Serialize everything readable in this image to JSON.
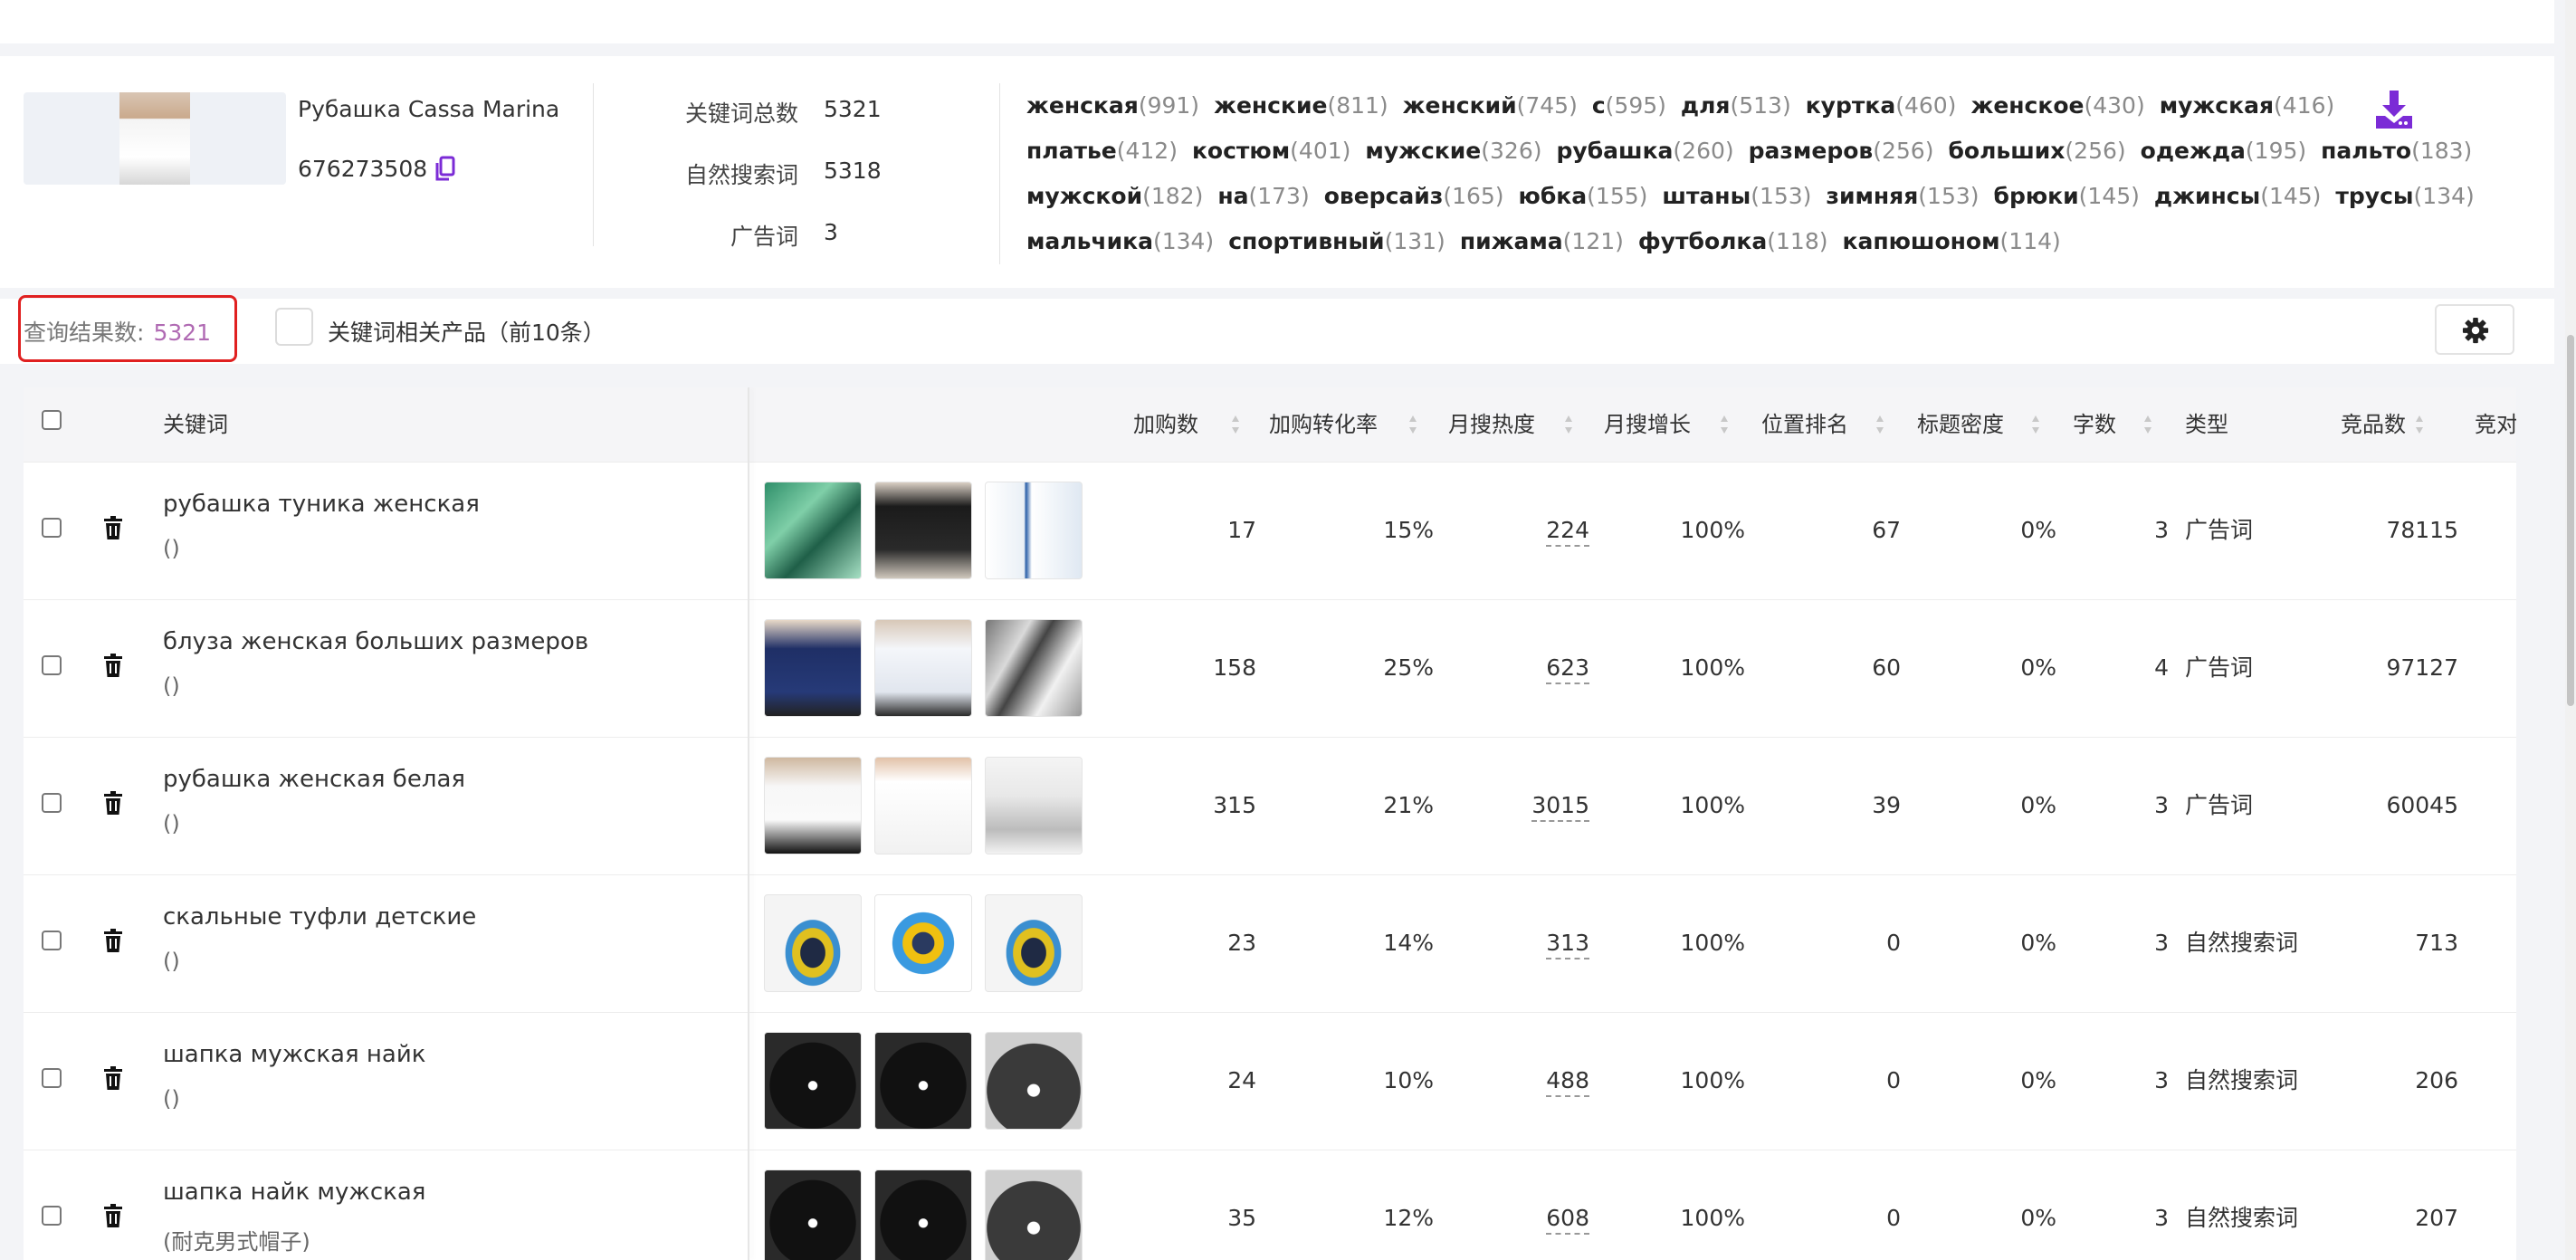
{
  "product": {
    "name": "Рубашка Cassa Marina",
    "id": "676273508"
  },
  "stats": {
    "total_label": "关键词总数",
    "total_value": "5321",
    "organic_label": "自然搜索词",
    "organic_value": "5318",
    "ad_label": "广告词",
    "ad_value": "3"
  },
  "keyword_cloud": [
    [
      [
        "женская",
        "(991)"
      ],
      [
        "женские",
        "(811)"
      ],
      [
        "женский",
        "(745)"
      ],
      [
        "с",
        "(595)"
      ],
      [
        "для",
        "(513)"
      ],
      [
        "куртка",
        "(460)"
      ],
      [
        "женское",
        "(430)"
      ],
      [
        "мужская",
        "(416)"
      ]
    ],
    [
      [
        "платье",
        "(412)"
      ],
      [
        "костюм",
        "(401)"
      ],
      [
        "мужские",
        "(326)"
      ],
      [
        "рубашка",
        "(260)"
      ],
      [
        "размеров",
        "(256)"
      ],
      [
        "больших",
        "(256)"
      ],
      [
        "одежда",
        "(195)"
      ],
      [
        "пальто",
        "(183)"
      ]
    ],
    [
      [
        "мужской",
        "(182)"
      ],
      [
        "на",
        "(173)"
      ],
      [
        "оверсайз",
        "(165)"
      ],
      [
        "юбка",
        "(155)"
      ],
      [
        "штаны",
        "(153)"
      ],
      [
        "зимняя",
        "(153)"
      ],
      [
        "брюки",
        "(145)"
      ],
      [
        "джинсы",
        "(145)"
      ],
      [
        "трусы",
        "(134)"
      ]
    ],
    [
      [
        "мальчика",
        "(134)"
      ],
      [
        "спортивный",
        "(131)"
      ],
      [
        "пижама",
        "(121)"
      ],
      [
        "футболка",
        "(118)"
      ],
      [
        "капюшоном",
        "(114)"
      ]
    ]
  ],
  "toolbar": {
    "result_label": "查询结果数:",
    "result_count": "5321",
    "related_label": "关键词相关产品（前10条）"
  },
  "columns": {
    "keyword": "关键词",
    "add_cart": "加购数",
    "add_cart_rate": "加购转化率",
    "monthly_heat": "月搜热度",
    "monthly_growth": "月搜增长",
    "position_rank": "位置排名",
    "title_density": "标题密度",
    "word_count": "字数",
    "type": "类型",
    "competitors": "竞品数",
    "competition": "竞对"
  },
  "rows": [
    {
      "keyword": "рубашка туника женская",
      "translation": "()",
      "add_cart": "17",
      "rate": "15%",
      "heat": "224",
      "growth": "100%",
      "rank": "67",
      "density": "0%",
      "words": "3",
      "type": "广告词",
      "competitors": "78115"
    },
    {
      "keyword": "блуза женская больших размеров",
      "translation": "()",
      "add_cart": "158",
      "rate": "25%",
      "heat": "623",
      "growth": "100%",
      "rank": "60",
      "density": "0%",
      "words": "4",
      "type": "广告词",
      "competitors": "97127"
    },
    {
      "keyword": "рубашка женская белая",
      "translation": "()",
      "add_cart": "315",
      "rate": "21%",
      "heat": "3015",
      "growth": "100%",
      "rank": "39",
      "density": "0%",
      "words": "3",
      "type": "广告词",
      "competitors": "60045"
    },
    {
      "keyword": "скальные туфли детские",
      "translation": "()",
      "add_cart": "23",
      "rate": "14%",
      "heat": "313",
      "growth": "100%",
      "rank": "0",
      "density": "0%",
      "words": "3",
      "type": "自然搜索词",
      "competitors": "713"
    },
    {
      "keyword": "шапка мужская найк",
      "translation": "()",
      "add_cart": "24",
      "rate": "10%",
      "heat": "488",
      "growth": "100%",
      "rank": "0",
      "density": "0%",
      "words": "3",
      "type": "自然搜索词",
      "competitors": "206"
    },
    {
      "keyword": "шапка найк мужская",
      "translation": "(耐克男式帽子)",
      "add_cart": "35",
      "rate": "12%",
      "heat": "608",
      "growth": "100%",
      "rank": "0",
      "density": "0%",
      "words": "3",
      "type": "自然搜索词",
      "competitors": "207"
    }
  ],
  "colors": {
    "accent_purple": "#7b2bd6",
    "result_count": "#b06ab3",
    "highlight_border": "#e02020"
  }
}
